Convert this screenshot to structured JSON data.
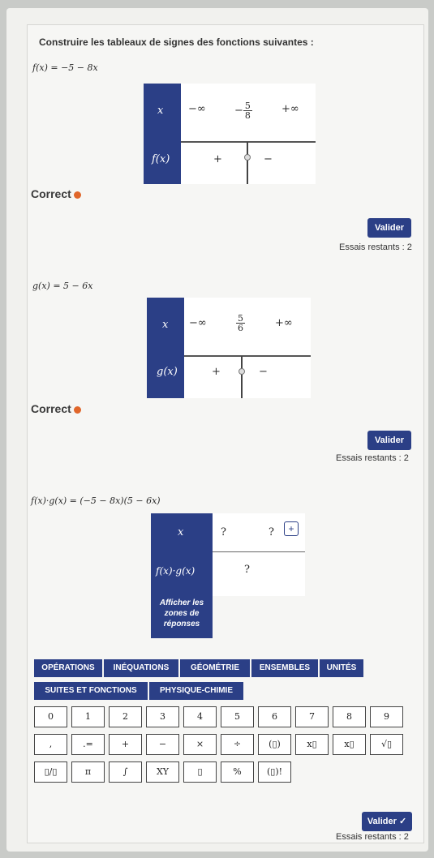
{
  "instructions": "Construire les tableaux de signes des fonctions suivantes :",
  "problems": [
    {
      "formula": "f(x) = −5 − 8x",
      "col_header": "x",
      "row_label": "f(x)",
      "x_values": [
        "−∞",
        "5",
        "8",
        "+∞"
      ],
      "neg_sign": "−",
      "signs": [
        "+",
        "−"
      ],
      "status": "Correct",
      "validate_label": "Valider",
      "remaining": "Essais restants : 2"
    },
    {
      "formula": "g(x) = 5 − 6x",
      "col_header": "x",
      "row_label": "g(x)",
      "x_values": [
        "−∞",
        "5",
        "6",
        "+∞"
      ],
      "signs": [
        "+",
        "−"
      ],
      "status": "Correct",
      "validate_label": "Valider",
      "remaining": "Essais restants : 2"
    },
    {
      "formula": "f(x)·g(x) = (−5 − 8x)(5 − 6x)",
      "col_header": "x",
      "row_label": "f(x)·g(x)",
      "x_values": [
        "?",
        "?"
      ],
      "cell_value": "?",
      "add_label": "+",
      "show_zones": [
        "Afficher les",
        "zones de",
        "réponses"
      ],
      "validate_label": "Valider ✓",
      "remaining": "Essais restants : 2"
    }
  ],
  "tabs": [
    "OPÉRATIONS",
    "INÉQUATIONS",
    "GÉOMÉTRIE",
    "ENSEMBLES",
    "UNITÉS",
    "SUITES ET FONCTIONS",
    "PHYSIQUE-CHIMIE"
  ],
  "keypad": {
    "row1": [
      "0",
      "1",
      "2",
      "3",
      "4",
      "5",
      "6",
      "7",
      "8",
      "9"
    ],
    "row2": [
      ",",
      ".=",
      "+",
      "−",
      "×",
      "÷",
      "(▯)",
      "x▯",
      "x▯",
      "√▯"
    ],
    "row3": [
      "▯/▯",
      "π",
      "∫",
      "XY",
      "▯",
      "%",
      "(▯)!"
    ]
  },
  "colors": {
    "accent": "#2b3f86",
    "status_dot": "#e0662a"
  }
}
